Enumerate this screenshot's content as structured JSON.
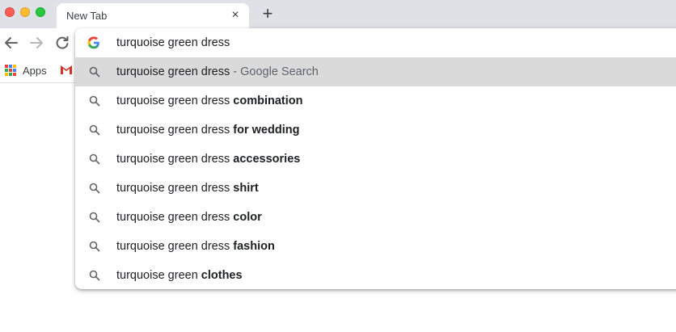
{
  "tab": {
    "title": "New Tab",
    "close_glyph": "×",
    "new_tab_glyph": "+"
  },
  "bookmarks": {
    "apps_label": "Apps",
    "gmail_icon": "gmail-icon"
  },
  "omnibox": {
    "input_value": "turquoise green dress",
    "suggestions": [
      {
        "query": "turquoise green dress",
        "bold": "",
        "separator": " - ",
        "description": "Google Search"
      },
      {
        "query": "turquoise green dress ",
        "bold": "combination"
      },
      {
        "query": "turquoise green dress ",
        "bold": "for wedding"
      },
      {
        "query": "turquoise green dress ",
        "bold": "accessories"
      },
      {
        "query": "turquoise green dress ",
        "bold": "shirt"
      },
      {
        "query": "turquoise green dress ",
        "bold": "color"
      },
      {
        "query": "turquoise green dress ",
        "bold": "fashion"
      },
      {
        "query": "turquoise green ",
        "bold": "clothes"
      }
    ]
  },
  "colors": {
    "titlebar": "#dee1e6",
    "highlight": "#dadada",
    "text": "#202124"
  }
}
